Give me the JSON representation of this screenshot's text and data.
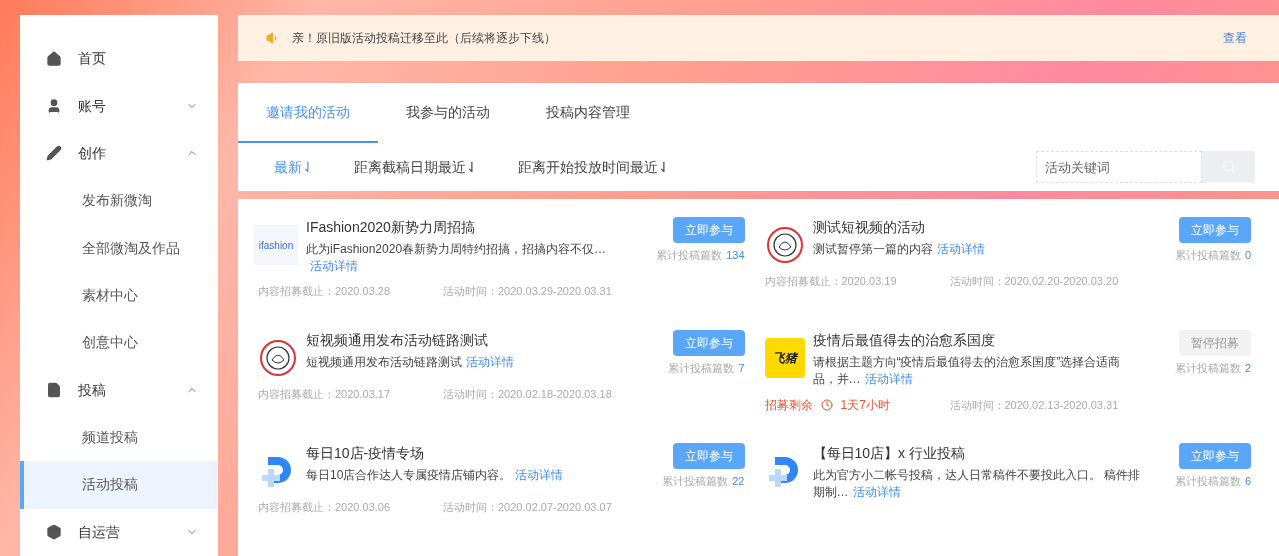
{
  "sidebar": {
    "items": [
      {
        "label": "首页",
        "kind": "home",
        "selected": false
      },
      {
        "label": "账号",
        "kind": "user",
        "expanded": false,
        "selected": false
      },
      {
        "label": "创作",
        "kind": "pen",
        "expanded": true,
        "selected": false,
        "children": [
          {
            "label": "发布新微淘",
            "selected": false
          },
          {
            "label": "全部微淘及作品",
            "selected": false
          },
          {
            "label": "素材中心",
            "selected": false
          },
          {
            "label": "创意中心",
            "selected": false
          }
        ]
      },
      {
        "label": "投稿",
        "kind": "file",
        "expanded": true,
        "selected": false,
        "children": [
          {
            "label": "频道投稿",
            "selected": false
          },
          {
            "label": "活动投稿",
            "selected": true
          }
        ]
      },
      {
        "label": "自运营",
        "kind": "box",
        "expanded": false,
        "selected": false
      }
    ]
  },
  "notice": {
    "text": "亲！原旧版活动投稿迁移至此（后续将逐步下线）",
    "link": "查看"
  },
  "tabs": [
    {
      "label": "邀请我的活动",
      "selected": true
    },
    {
      "label": "我参与的活动",
      "selected": false
    },
    {
      "label": "投稿内容管理",
      "selected": false
    }
  ],
  "sort_options": [
    {
      "label": "最新⇃",
      "selected": true
    },
    {
      "label": "距离截稿日期最近⇃",
      "selected": false
    },
    {
      "label": "距离开始投放时间最近⇃",
      "selected": false
    }
  ],
  "search": {
    "placeholder": "活动关键词"
  },
  "activities": [
    {
      "kind": "ifashion",
      "logo_text": "ifashion",
      "title": "IFashion2020新势力周招搞",
      "description": "此为iFashion2020春新势力周特约招搞，招搞内容不仅…",
      "detail_link": "活动详情",
      "button": "立即参与",
      "disabled": false,
      "count_label": "累计投稿篇数",
      "count": "134",
      "deadline": "内容招募截止：2020.03.28",
      "period": "活动时间：2020.03.29-2020.03.31"
    },
    {
      "kind": "ajax",
      "title": "测试短视频的活动",
      "description": "测试暂停第一篇的内容",
      "detail_link": "活动详情",
      "button": "立即参与",
      "disabled": false,
      "count_label": "累计投稿篇数",
      "count": "0",
      "deadline": "内容招募截止：2020.03.19",
      "period": "活动时间：2020.02.20-2020.03.20"
    },
    {
      "kind": "ajax",
      "title": "短视频通用发布活动链路测试",
      "description": "短视频通用发布活动链路测试",
      "detail_link": "活动详情",
      "button": "立即参与",
      "disabled": false,
      "count_label": "累计投稿篇数",
      "count": "7",
      "deadline": "内容招募截止：2020.03.17",
      "period": "活动时间：2020.02.18-2020.03.18"
    },
    {
      "kind": "feizhu",
      "logo_text": "飞猪",
      "title": "疫情后最值得去的治愈系国度",
      "description": "请根据主题方向“疫情后最值得去的治愈系国度”选择合适商品，并…",
      "detail_link": "活动详情",
      "button": "暂停招募",
      "disabled": true,
      "count_label": "累计投稿篇数",
      "count": "2",
      "countdown_label": "招募剩余",
      "countdown": "1天7小时",
      "period": "活动时间：2020.02.13-2020.03.31"
    },
    {
      "kind": "dplus",
      "title": "每日10店-疫情专场",
      "description": "每日10店合作达人专属疫情店铺内容。",
      "detail_link": "活动详情",
      "button": "立即参与",
      "disabled": false,
      "count_label": "累计投稿篇数",
      "count": "22",
      "deadline": "内容招募截止：2020.03.06",
      "period": "活动时间：2020.02.07-2020.03.07"
    },
    {
      "kind": "dplus",
      "title": "【每日10店】x 行业投稿",
      "description": "此为官方小二帐号投稿，达人日常稿件不要投此入口。 稿件排期制…",
      "detail_link": "活动详情",
      "button": "立即参与",
      "disabled": false,
      "count_label": "累计投稿篇数",
      "count": "6"
    }
  ]
}
